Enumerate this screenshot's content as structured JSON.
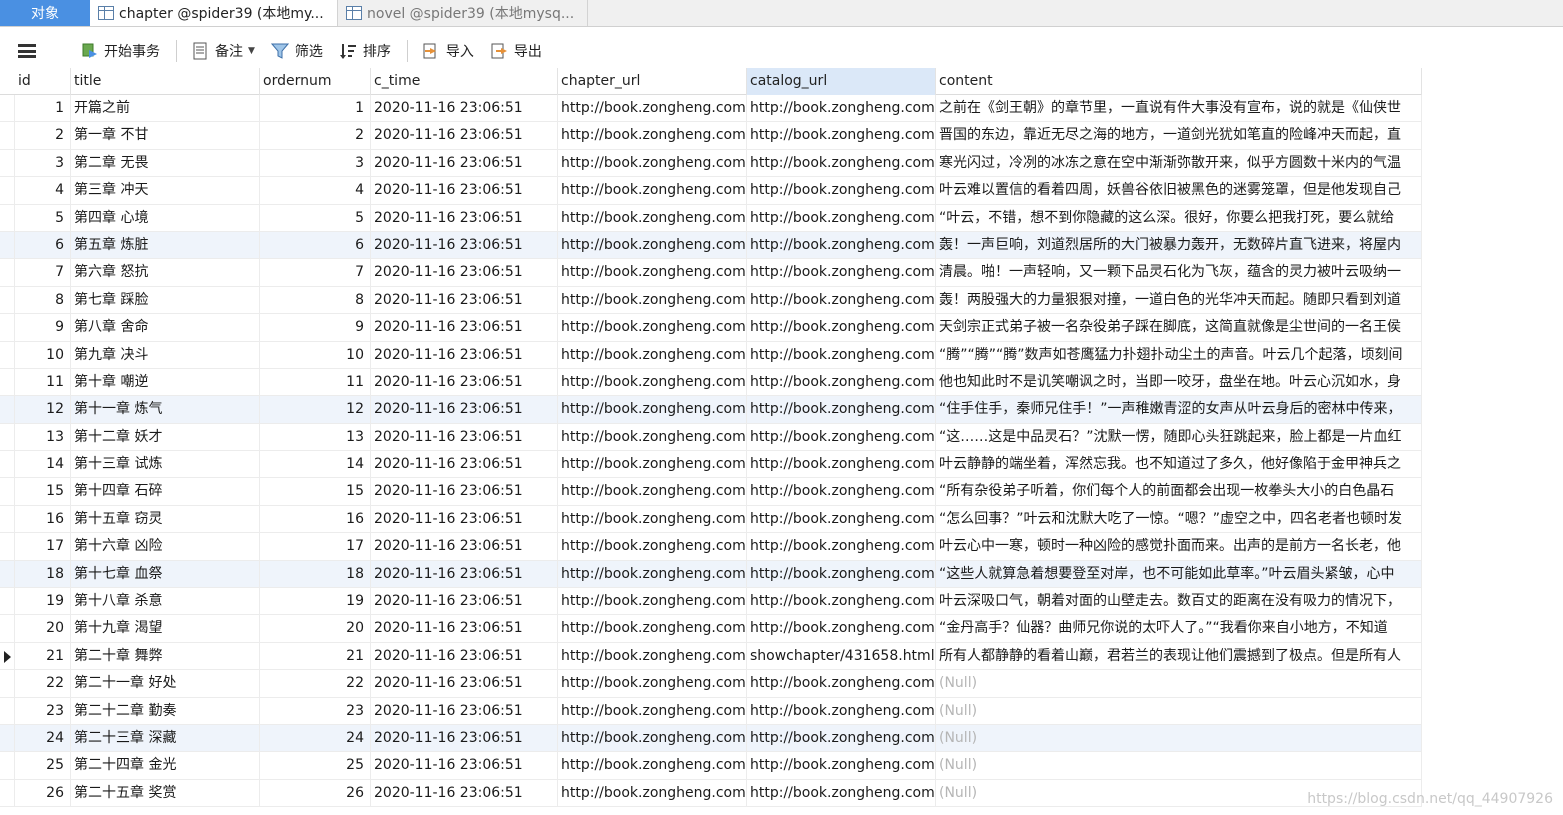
{
  "tabs": [
    {
      "label": "对象"
    },
    {
      "label": "chapter @spider39 (本地my..."
    },
    {
      "label": "novel @spider39 (本地mysq..."
    }
  ],
  "toolbar": {
    "begin_transaction": "开始事务",
    "memo": "备注",
    "filter": "筛选",
    "sort": "排序",
    "import": "导入",
    "export": "导出"
  },
  "columns": [
    "id",
    "title",
    "ordernum",
    "c_time",
    "chapter_url",
    "catalog_url",
    "content"
  ],
  "rows": [
    {
      "id": "1",
      "title": "开篇之前",
      "ordernum": "1",
      "c_time": "2020-11-16 23:06:51",
      "chapter_url": "http://book.zongheng.com",
      "catalog_url": "http://book.zongheng.com",
      "content": "之前在《剑王朝》的章节里，一直说有件大事没有宣布，说的就是《仙侠世"
    },
    {
      "id": "2",
      "title": "第一章 不甘",
      "ordernum": "2",
      "c_time": "2020-11-16 23:06:51",
      "chapter_url": "http://book.zongheng.com",
      "catalog_url": "http://book.zongheng.com",
      "content": "晋国的东边，靠近无尽之海的地方，一道剑光犹如笔直的险峰冲天而起，直"
    },
    {
      "id": "3",
      "title": "第二章 无畏",
      "ordernum": "3",
      "c_time": "2020-11-16 23:06:51",
      "chapter_url": "http://book.zongheng.com",
      "catalog_url": "http://book.zongheng.com",
      "content": "寒光闪过，冷冽的冰冻之意在空中渐渐弥散开来，似乎方圆数十米内的气温"
    },
    {
      "id": "4",
      "title": "第三章 冲天",
      "ordernum": "4",
      "c_time": "2020-11-16 23:06:51",
      "chapter_url": "http://book.zongheng.com",
      "catalog_url": "http://book.zongheng.com",
      "content": "叶云难以置信的看着四周，妖兽谷依旧被黑色的迷雾笼罩，但是他发现自己"
    },
    {
      "id": "5",
      "title": "第四章 心境",
      "ordernum": "5",
      "c_time": "2020-11-16 23:06:51",
      "chapter_url": "http://book.zongheng.com",
      "catalog_url": "http://book.zongheng.com",
      "content": "“叶云，不错，想不到你隐藏的这么深。很好，你要么把我打死，要么就给"
    },
    {
      "id": "6",
      "title": "第五章 炼脏",
      "ordernum": "6",
      "c_time": "2020-11-16 23:06:51",
      "chapter_url": "http://book.zongheng.com",
      "catalog_url": "http://book.zongheng.com",
      "content": "轰！一声巨响，刘道烈居所的大门被暴力轰开，无数碎片直飞进来，将屋内"
    },
    {
      "id": "7",
      "title": "第六章 怒抗",
      "ordernum": "7",
      "c_time": "2020-11-16 23:06:51",
      "chapter_url": "http://book.zongheng.com",
      "catalog_url": "http://book.zongheng.com",
      "content": "清晨。啪！一声轻响，又一颗下品灵石化为飞灰，蕴含的灵力被叶云吸纳一"
    },
    {
      "id": "8",
      "title": "第七章 踩脸",
      "ordernum": "8",
      "c_time": "2020-11-16 23:06:51",
      "chapter_url": "http://book.zongheng.com",
      "catalog_url": "http://book.zongheng.com",
      "content": "轰！两股强大的力量狠狠对撞，一道白色的光华冲天而起。随即只看到刘道"
    },
    {
      "id": "9",
      "title": "第八章 舍命",
      "ordernum": "9",
      "c_time": "2020-11-16 23:06:51",
      "chapter_url": "http://book.zongheng.com",
      "catalog_url": "http://book.zongheng.com",
      "content": "天剑宗正式弟子被一名杂役弟子踩在脚底，这简直就像是尘世间的一名王侯"
    },
    {
      "id": "10",
      "title": "第九章 决斗",
      "ordernum": "10",
      "c_time": "2020-11-16 23:06:51",
      "chapter_url": "http://book.zongheng.com",
      "catalog_url": "http://book.zongheng.com",
      "content": "“腾”“腾”“腾”数声如苍鹰猛力扑翅扑动尘土的声音。叶云几个起落，顷刻间"
    },
    {
      "id": "11",
      "title": "第十章 嘲逆",
      "ordernum": "11",
      "c_time": "2020-11-16 23:06:51",
      "chapter_url": "http://book.zongheng.com",
      "catalog_url": "http://book.zongheng.com",
      "content": "他也知此时不是讥笑嘲讽之时，当即一咬牙，盘坐在地。叶云心沉如水，身"
    },
    {
      "id": "12",
      "title": "第十一章 炼气",
      "ordernum": "12",
      "c_time": "2020-11-16 23:06:51",
      "chapter_url": "http://book.zongheng.com",
      "catalog_url": "http://book.zongheng.com",
      "content": "“住手住手，秦师兄住手！”一声稚嫩青涩的女声从叶云身后的密林中传来，"
    },
    {
      "id": "13",
      "title": "第十二章 妖才",
      "ordernum": "13",
      "c_time": "2020-11-16 23:06:51",
      "chapter_url": "http://book.zongheng.com",
      "catalog_url": "http://book.zongheng.com",
      "content": "“这……这是中品灵石？”沈默一愣，随即心头狂跳起来，脸上都是一片血红"
    },
    {
      "id": "14",
      "title": "第十三章 试炼",
      "ordernum": "14",
      "c_time": "2020-11-16 23:06:51",
      "chapter_url": "http://book.zongheng.com",
      "catalog_url": "http://book.zongheng.com",
      "content": "叶云静静的端坐着，浑然忘我。也不知道过了多久，他好像陷于金甲神兵之"
    },
    {
      "id": "15",
      "title": "第十四章 石碎",
      "ordernum": "15",
      "c_time": "2020-11-16 23:06:51",
      "chapter_url": "http://book.zongheng.com",
      "catalog_url": "http://book.zongheng.com",
      "content": "“所有杂役弟子听着，你们每个人的前面都会出现一枚拳头大小的白色晶石"
    },
    {
      "id": "16",
      "title": "第十五章 窃灵",
      "ordernum": "16",
      "c_time": "2020-11-16 23:06:51",
      "chapter_url": "http://book.zongheng.com",
      "catalog_url": "http://book.zongheng.com",
      "content": "“怎么回事？”叶云和沈默大吃了一惊。“嗯？”虚空之中，四名老者也顿时发"
    },
    {
      "id": "17",
      "title": "第十六章 凶险",
      "ordernum": "17",
      "c_time": "2020-11-16 23:06:51",
      "chapter_url": "http://book.zongheng.com",
      "catalog_url": "http://book.zongheng.com",
      "content": "叶云心中一寒，顿时一种凶险的感觉扑面而来。出声的是前方一名长老，他"
    },
    {
      "id": "18",
      "title": "第十七章 血祭",
      "ordernum": "18",
      "c_time": "2020-11-16 23:06:51",
      "chapter_url": "http://book.zongheng.com",
      "catalog_url": "http://book.zongheng.com",
      "content": "“这些人就算急着想要登至对岸，也不可能如此草率。”叶云眉头紧皱，心中"
    },
    {
      "id": "19",
      "title": "第十八章 杀意",
      "ordernum": "19",
      "c_time": "2020-11-16 23:06:51",
      "chapter_url": "http://book.zongheng.com",
      "catalog_url": "http://book.zongheng.com",
      "content": "叶云深吸口气，朝着对面的山壁走去。数百丈的距离在没有吸力的情况下，"
    },
    {
      "id": "20",
      "title": "第十九章 渴望",
      "ordernum": "20",
      "c_time": "2020-11-16 23:06:51",
      "chapter_url": "http://book.zongheng.com",
      "catalog_url": "http://book.zongheng.com",
      "content": "“金丹高手？仙器？曲师兄你说的太吓人了。”“我看你来自小地方，不知道"
    },
    {
      "id": "21",
      "title": "第二十章 舞弊",
      "ordernum": "21",
      "c_time": "2020-11-16 23:06:51",
      "chapter_url": "http://book.zongheng.com",
      "catalog_url": "showchapter/431658.html",
      "content": "所有人都静静的看着山巅，君若兰的表现让他们震撼到了极点。但是所有人"
    },
    {
      "id": "22",
      "title": "第二十一章  好处",
      "ordernum": "22",
      "c_time": "2020-11-16 23:06:51",
      "chapter_url": "http://book.zongheng.com",
      "catalog_url": "http://book.zongheng.com",
      "content": "(Null)"
    },
    {
      "id": "23",
      "title": "第二十二章 勤奏",
      "ordernum": "23",
      "c_time": "2020-11-16 23:06:51",
      "chapter_url": "http://book.zongheng.com",
      "catalog_url": "http://book.zongheng.com",
      "content": "(Null)"
    },
    {
      "id": "24",
      "title": "第二十三章 深藏",
      "ordernum": "24",
      "c_time": "2020-11-16 23:06:51",
      "chapter_url": "http://book.zongheng.com",
      "catalog_url": "http://book.zongheng.com",
      "content": "(Null)"
    },
    {
      "id": "25",
      "title": "第二十四章 金光",
      "ordernum": "25",
      "c_time": "2020-11-16 23:06:51",
      "chapter_url": "http://book.zongheng.com",
      "catalog_url": "http://book.zongheng.com",
      "content": "(Null)"
    },
    {
      "id": "26",
      "title": "第二十五章 奖赏",
      "ordernum": "26",
      "c_time": "2020-11-16 23:06:51",
      "chapter_url": "http://book.zongheng.com",
      "catalog_url": "http://book.zongheng.com",
      "content": "(Null)"
    }
  ],
  "current_row_id": "21",
  "watermark": "https://blog.csdn.net/qq_44907926",
  "colors": {
    "accent": "#4a90e2",
    "alt_row": "#eff4fb",
    "selected_header": "#dbe8f8",
    "null_text": "#b5b5b5"
  },
  "icons": {
    "menu": "hamburger-icon",
    "begin": "transaction-icon",
    "memo": "memo-icon",
    "filter": "filter-icon",
    "sort": "sort-icon",
    "import": "import-icon",
    "export": "export-icon",
    "table": "table-icon",
    "row_marker": "current-row-arrow-icon"
  }
}
